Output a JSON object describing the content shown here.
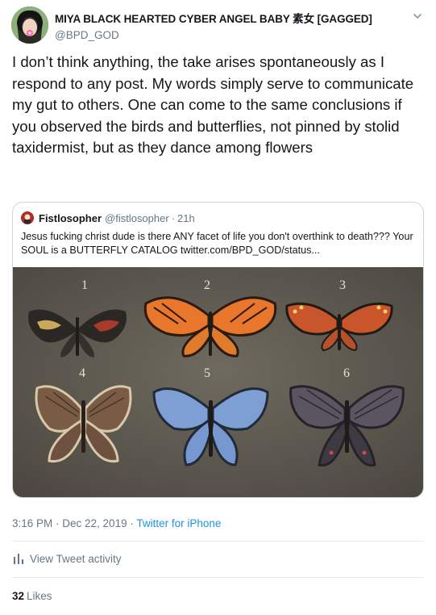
{
  "tweet": {
    "author": {
      "display_name": "MIYA BLACK HEARTED CYBER ANGEL BABY 素女 [GAGGED]",
      "handle": "@BPD_GOD"
    },
    "text": "I don’t think anything, the take arises spontaneously as I respond to any post. My words simply serve to communicate my gut to others. One can come to the same conclusions if you observed the birds and butterflies, not pinned by stolid taxidermist, but as they dance among flowers",
    "quoted": {
      "display_name": "Fistlosopher",
      "handle": "@fistlosopher",
      "separator": "·",
      "time": "21h",
      "text": "Jesus fucking christ dude is there ANY facet of life you don't overthink to death??? Your SOUL is a BUTTERFLY CATALOG twitter.com/BPD_GOD/status...",
      "media": {
        "numbers": [
          "1",
          "2",
          "3",
          "4",
          "5",
          "6"
        ]
      }
    },
    "timestamp": "3:16 PM · Dec 22, 2019",
    "separator": " · ",
    "source": "Twitter for iPhone",
    "activity_label": "View Tweet activity",
    "likes_count": "32",
    "likes_label": "Likes"
  },
  "icons": {
    "caret": "chevron-down-icon",
    "activity": "bar-chart-icon"
  },
  "colors": {
    "link": "#1b95e0",
    "secondary_text": "#657786",
    "border": "#ccd6dd"
  }
}
